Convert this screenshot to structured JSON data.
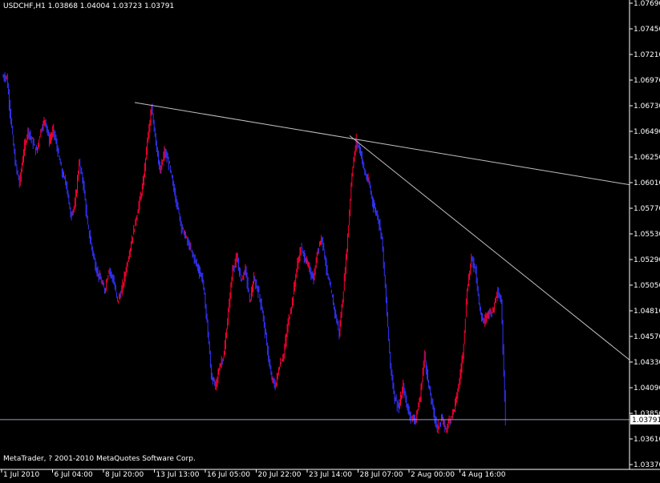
{
  "header": {
    "symbol": "USDCHF,H1",
    "ohlc": "1.03868 1.04004 1.03723 1.03791"
  },
  "copyright": "MetaTrader, ? 2001-2010 MetaQuotes Software Corp.",
  "colors": {
    "background": "#000000",
    "axis": "#ffffff",
    "candle_up": "#ff0033",
    "candle_down": "#3333ff",
    "trendline": "#c0c0c0",
    "price_line": "#9a9acd"
  },
  "chart_data": {
    "type": "line",
    "title": "USDCHF,H1",
    "xlabel": "",
    "ylabel": "",
    "ylim": [
      1.0337,
      1.0769
    ],
    "grid": false,
    "y_ticks": [
      "1.07690",
      "1.07450",
      "1.07210",
      "1.06970",
      "1.06730",
      "1.06490",
      "1.06250",
      "1.06010",
      "1.05770",
      "1.05530",
      "1.05290",
      "1.05050",
      "1.04810",
      "1.04570",
      "1.04330",
      "1.04090",
      "1.03850",
      "1.03610",
      "1.03370"
    ],
    "x_ticks": [
      "1 Jul 2010",
      "6 Jul 04:00",
      "8 Jul 20:00",
      "13 Jul 13:00",
      "16 Jul 05:00",
      "20 Jul 22:00",
      "23 Jul 14:00",
      "28 Jul 07:00",
      "2 Aug 00:00",
      "4 Aug 16:00"
    ],
    "current_price": 1.03791,
    "series": [
      {
        "values": [
          1.07,
          1.066,
          1.062,
          1.06,
          1.063,
          1.065,
          1.064,
          1.063,
          1.065,
          1.066,
          1.064,
          1.065,
          1.063,
          1.061,
          1.06,
          1.057,
          1.058,
          1.062,
          1.06,
          1.056,
          1.054,
          1.052,
          1.051,
          1.05,
          1.052,
          1.051,
          1.049,
          1.05,
          1.052,
          1.054,
          1.056,
          1.058,
          1.06,
          1.064,
          1.067,
          1.064,
          1.061,
          1.063,
          1.062,
          1.06,
          1.058,
          1.056,
          1.055,
          1.054,
          1.053,
          1.052,
          1.051,
          1.047,
          1.042,
          1.041,
          1.043,
          1.044,
          1.048,
          1.052,
          1.053,
          1.051,
          1.052,
          1.049,
          1.051,
          1.05,
          1.048,
          1.045,
          1.042,
          1.041,
          1.043,
          1.044,
          1.047,
          1.049,
          1.052,
          1.054,
          1.053,
          1.052,
          1.051,
          1.054,
          1.055,
          1.052,
          1.05,
          1.048,
          1.046,
          1.05,
          1.055,
          1.061,
          1.064,
          1.063,
          1.061,
          1.06,
          1.058,
          1.057,
          1.055,
          1.049,
          1.043,
          1.04,
          1.039,
          1.041,
          1.039,
          1.038,
          1.038,
          1.04,
          1.044,
          1.041,
          1.039,
          1.037,
          1.038,
          1.037,
          1.038,
          1.039,
          1.041,
          1.044,
          1.05,
          1.053,
          1.052,
          1.048,
          1.047,
          1.048,
          1.048,
          1.05,
          1.049,
          1.038
        ]
      }
    ],
    "trendlines": [
      {
        "x_start": "8 Jul 20:00",
        "y_start": 1.0676,
        "x_end": "off-chart",
        "y_end": 1.0599
      },
      {
        "x_start": "28 Jul 07:00",
        "y_start": 1.0645,
        "x_end": "off-chart",
        "y_end": 1.0435
      }
    ]
  }
}
